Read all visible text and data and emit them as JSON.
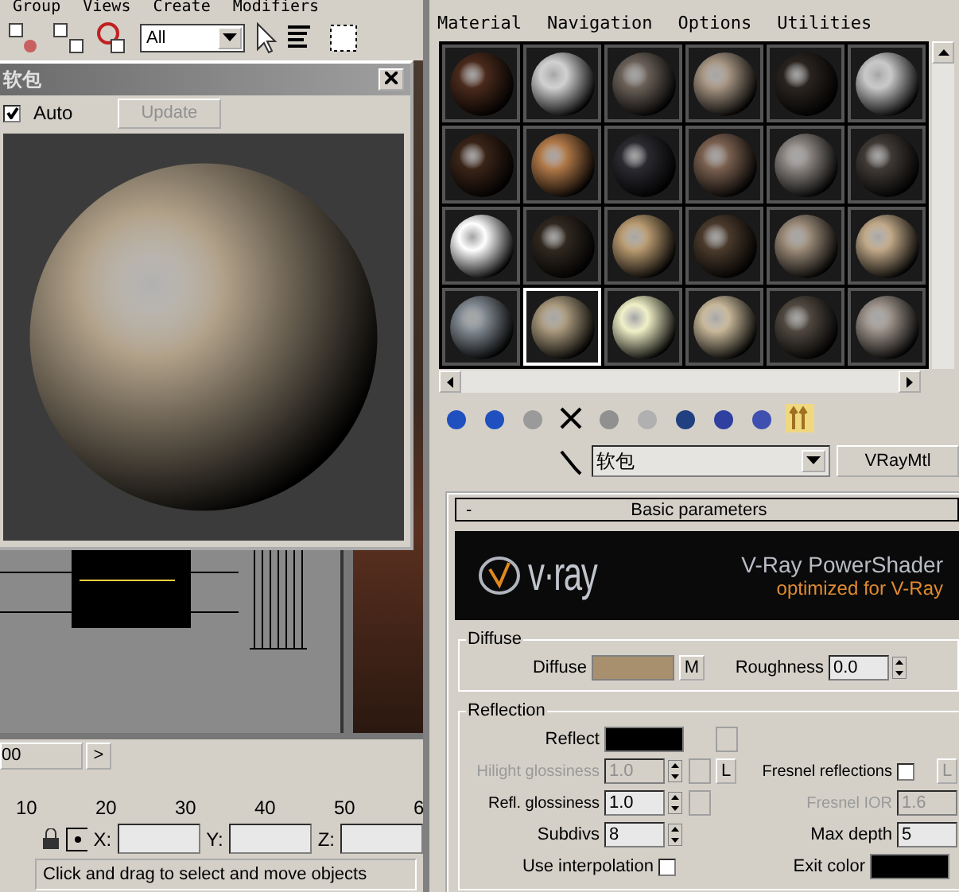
{
  "main_menu": [
    "Group",
    "Views",
    "Create",
    "Modifiers"
  ],
  "main_toolbar": {
    "selection_filter": "All"
  },
  "preview_window": {
    "title": "软包",
    "auto": {
      "label": "Auto",
      "checked": true
    },
    "update": {
      "label": "Update",
      "disabled": true
    }
  },
  "timeline": {
    "frame": "00",
    "next": ">",
    "ticks": [
      "10",
      "20",
      "30",
      "40",
      "50",
      "6"
    ]
  },
  "coordinates": [
    {
      "label": "X:"
    },
    {
      "label": "Y:"
    },
    {
      "label": "Z:"
    }
  ],
  "status_bar": "Click and drag to select and move objects",
  "material_editor": {
    "menu": [
      "Material",
      "Navigation",
      "Options",
      "Utilities"
    ],
    "slots": [
      {
        "selected": false,
        "color": "#4a2a1c"
      },
      {
        "selected": false,
        "color": "#d0d0d0"
      },
      {
        "selected": false,
        "color": "#6a6058"
      },
      {
        "selected": false,
        "color": "#a59482"
      },
      {
        "selected": false,
        "color": "#2a2420"
      },
      {
        "selected": false,
        "color": "#c8c8c8"
      },
      {
        "selected": false,
        "color": "#3a2418"
      },
      {
        "selected": false,
        "color": "#b07848"
      },
      {
        "selected": false,
        "color": "#2a2a30"
      },
      {
        "selected": false,
        "color": "#7a6050"
      },
      {
        "selected": false,
        "color": "#8a8480"
      },
      {
        "selected": false,
        "color": "#403a36"
      },
      {
        "selected": false,
        "color": "#ffffff"
      },
      {
        "selected": false,
        "color": "#302820"
      },
      {
        "selected": false,
        "color": "#b89a70"
      },
      {
        "selected": false,
        "color": "#4a3a2c"
      },
      {
        "selected": false,
        "color": "#9a8a78"
      },
      {
        "selected": false,
        "color": "#c0a888"
      },
      {
        "selected": false,
        "color": "#808890"
      },
      {
        "selected": true,
        "color": "#a8987c"
      },
      {
        "selected": false,
        "color": "#f0f0c8"
      },
      {
        "selected": false,
        "color": "#c8b89a"
      },
      {
        "selected": false,
        "color": "#504840"
      },
      {
        "selected": false,
        "color": "#9a9088"
      }
    ],
    "material_name": "软包",
    "material_type": "VRayMtl",
    "rollout": {
      "toggle": "-",
      "title": "Basic parameters"
    },
    "banner": {
      "logo": "v·ray",
      "title": "V-Ray PowerShader",
      "subtitle": "optimized for V-Ray"
    },
    "diffuse": {
      "group": "Diffuse",
      "label": "Diffuse",
      "color": "#a8906f",
      "map": "M",
      "roughness_label": "Roughness",
      "roughness": "0.0"
    },
    "reflection": {
      "group": "Reflection",
      "reflect": {
        "label": "Reflect",
        "color": "#000000"
      },
      "hilight_glossiness": {
        "label": "Hilight glossiness",
        "value": "1.0",
        "disabled": true,
        "lock": "L"
      },
      "fresnel_reflections": {
        "label": "Fresnel reflections",
        "checked": false,
        "lock": "L"
      },
      "refl_glossiness": {
        "label": "Refl. glossiness",
        "value": "1.0",
        "disabled": false
      },
      "fresnel_ior": {
        "label": "Fresnel IOR",
        "value": "1.6",
        "disabled": true
      },
      "subdivs": {
        "label": "Subdivs",
        "value": "8"
      },
      "max_depth": {
        "label": "Max depth",
        "value": "5"
      },
      "use_interpolation": {
        "label": "Use interpolation",
        "checked": false
      },
      "exit_color": {
        "label": "Exit color",
        "color": "#000000"
      }
    }
  }
}
